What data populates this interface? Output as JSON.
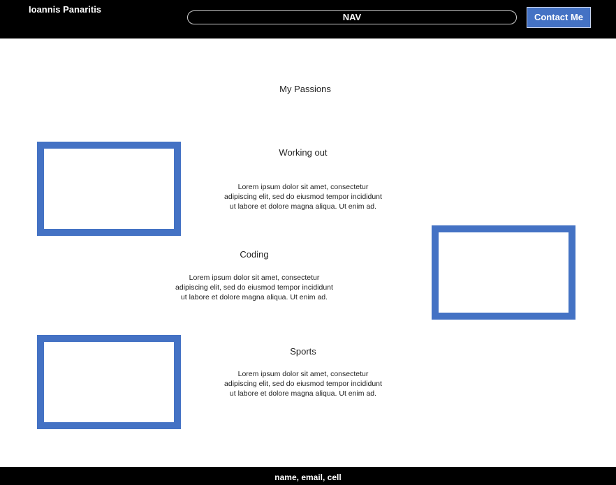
{
  "header": {
    "site_name": "Ioannis Panaritis",
    "nav_label": "NAV",
    "contact_label": "Contact Me"
  },
  "main": {
    "page_title": "My Passions",
    "sections": [
      {
        "title": "Working out",
        "text": "Lorem ipsum dolor sit amet, consectetur adipiscing elit, sed do eiusmod tempor incididunt ut labore et dolore magna aliqua. Ut enim ad."
      },
      {
        "title": "Coding",
        "text": "Lorem ipsum dolor sit amet, consectetur adipiscing elit, sed do eiusmod tempor incididunt ut labore et dolore magna aliqua. Ut enim ad."
      },
      {
        "title": "Sports",
        "text": "Lorem ipsum dolor sit amet, consectetur adipiscing elit, sed do eiusmod tempor incididunt ut labore et dolore magna aliqua. Ut enim ad."
      }
    ]
  },
  "footer": {
    "text": "name, email, cell"
  },
  "colors": {
    "header_bg": "#000000",
    "accent": "#4472c4",
    "footer_bg": "#000000"
  }
}
